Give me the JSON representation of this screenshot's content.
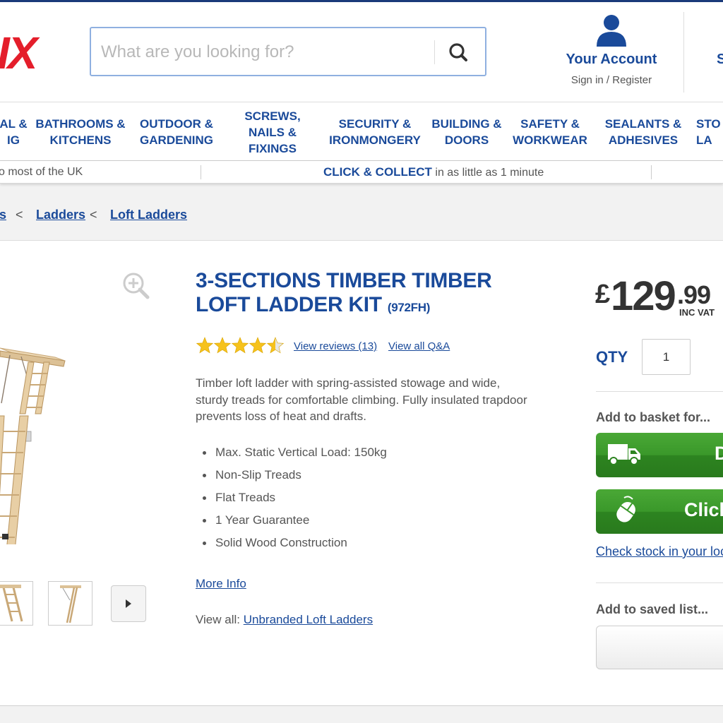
{
  "header": {
    "logo_text": "IX",
    "search": {
      "placeholder": "What are you looking for?",
      "value": ""
    },
    "account": {
      "title": "Your Account",
      "subtitle": "Sign in / Register"
    },
    "right_fragment": "S"
  },
  "nav": {
    "items": [
      {
        "label": "AL &\nIG"
      },
      {
        "label": "BATHROOMS &\nKITCHENS"
      },
      {
        "label": "OUTDOOR &\nGARDENING"
      },
      {
        "label": "SCREWS,\nNAILS &\nFIXINGS"
      },
      {
        "label": "SECURITY &\nIRONMONGERY"
      },
      {
        "label": "BUILDING &\nDOORS"
      },
      {
        "label": "SAFETY &\nWORKWEAR"
      },
      {
        "label": "SEALANTS &\nADHESIVES"
      },
      {
        "label": "STO\nLA"
      }
    ]
  },
  "promo": {
    "left_text": "o most of the UK",
    "cc_bold": "CLICK & COLLECT",
    "cc_rest": " in as little as 1 minute"
  },
  "breadcrumb": {
    "items": [
      "s",
      "Ladders",
      "Loft Ladders"
    ],
    "separator": "<"
  },
  "product": {
    "title": "3-SECTIONS TIMBER TIMBER LOFT LADDER KIT",
    "code": "(972FH)",
    "rating": 4.5,
    "reviews_link": "View reviews (13)",
    "qa_link": "View all Q&A",
    "description": "Timber loft ladder with spring-assisted stowage and wide, sturdy treads for comfortable climbing. Fully insulated trapdoor prevents loss of heat and drafts.",
    "features": [
      "Max. Static Vertical Load: 150kg",
      "Non-Slip Treads",
      "Flat Treads",
      "1 Year Guarantee",
      "Solid Wood Construction"
    ],
    "more_info": "More Info",
    "view_all_prefix": "View all: ",
    "view_all_link": "Unbranded Loft Ladders"
  },
  "purchase": {
    "currency": "£",
    "price_pounds": "129",
    "price_pence": ".99",
    "vat_label": "INC VAT",
    "qty_label": "QTY",
    "qty_value": "1",
    "add_to_basket_label": "Add to basket for...",
    "delivery_button": "D",
    "collect_button": "Click",
    "check_stock": "Check stock in your loc",
    "saved_list_label": "Add to saved list..."
  },
  "colors": {
    "brand_blue": "#1a4a9a",
    "logo_red": "#e41e2b",
    "button_green": "#3a982a",
    "star_yellow": "#f6c21c"
  }
}
